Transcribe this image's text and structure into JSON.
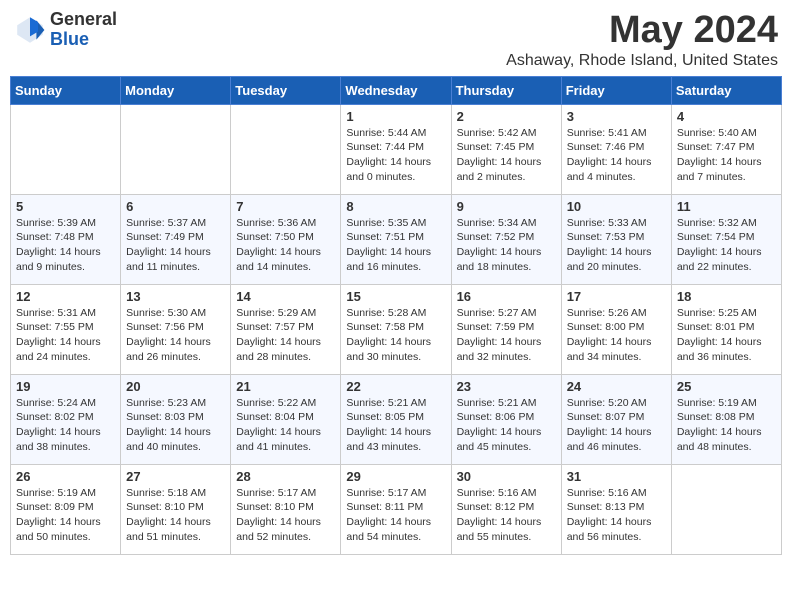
{
  "header": {
    "logo_general": "General",
    "logo_blue": "Blue",
    "title": "May 2024",
    "location": "Ashaway, Rhode Island, United States"
  },
  "weekdays": [
    "Sunday",
    "Monday",
    "Tuesday",
    "Wednesday",
    "Thursday",
    "Friday",
    "Saturday"
  ],
  "weeks": [
    [
      {
        "day": "",
        "sunrise": "",
        "sunset": "",
        "daylight": ""
      },
      {
        "day": "",
        "sunrise": "",
        "sunset": "",
        "daylight": ""
      },
      {
        "day": "",
        "sunrise": "",
        "sunset": "",
        "daylight": ""
      },
      {
        "day": "1",
        "sunrise": "Sunrise: 5:44 AM",
        "sunset": "Sunset: 7:44 PM",
        "daylight": "Daylight: 14 hours and 0 minutes."
      },
      {
        "day": "2",
        "sunrise": "Sunrise: 5:42 AM",
        "sunset": "Sunset: 7:45 PM",
        "daylight": "Daylight: 14 hours and 2 minutes."
      },
      {
        "day": "3",
        "sunrise": "Sunrise: 5:41 AM",
        "sunset": "Sunset: 7:46 PM",
        "daylight": "Daylight: 14 hours and 4 minutes."
      },
      {
        "day": "4",
        "sunrise": "Sunrise: 5:40 AM",
        "sunset": "Sunset: 7:47 PM",
        "daylight": "Daylight: 14 hours and 7 minutes."
      }
    ],
    [
      {
        "day": "5",
        "sunrise": "Sunrise: 5:39 AM",
        "sunset": "Sunset: 7:48 PM",
        "daylight": "Daylight: 14 hours and 9 minutes."
      },
      {
        "day": "6",
        "sunrise": "Sunrise: 5:37 AM",
        "sunset": "Sunset: 7:49 PM",
        "daylight": "Daylight: 14 hours and 11 minutes."
      },
      {
        "day": "7",
        "sunrise": "Sunrise: 5:36 AM",
        "sunset": "Sunset: 7:50 PM",
        "daylight": "Daylight: 14 hours and 14 minutes."
      },
      {
        "day": "8",
        "sunrise": "Sunrise: 5:35 AM",
        "sunset": "Sunset: 7:51 PM",
        "daylight": "Daylight: 14 hours and 16 minutes."
      },
      {
        "day": "9",
        "sunrise": "Sunrise: 5:34 AM",
        "sunset": "Sunset: 7:52 PM",
        "daylight": "Daylight: 14 hours and 18 minutes."
      },
      {
        "day": "10",
        "sunrise": "Sunrise: 5:33 AM",
        "sunset": "Sunset: 7:53 PM",
        "daylight": "Daylight: 14 hours and 20 minutes."
      },
      {
        "day": "11",
        "sunrise": "Sunrise: 5:32 AM",
        "sunset": "Sunset: 7:54 PM",
        "daylight": "Daylight: 14 hours and 22 minutes."
      }
    ],
    [
      {
        "day": "12",
        "sunrise": "Sunrise: 5:31 AM",
        "sunset": "Sunset: 7:55 PM",
        "daylight": "Daylight: 14 hours and 24 minutes."
      },
      {
        "day": "13",
        "sunrise": "Sunrise: 5:30 AM",
        "sunset": "Sunset: 7:56 PM",
        "daylight": "Daylight: 14 hours and 26 minutes."
      },
      {
        "day": "14",
        "sunrise": "Sunrise: 5:29 AM",
        "sunset": "Sunset: 7:57 PM",
        "daylight": "Daylight: 14 hours and 28 minutes."
      },
      {
        "day": "15",
        "sunrise": "Sunrise: 5:28 AM",
        "sunset": "Sunset: 7:58 PM",
        "daylight": "Daylight: 14 hours and 30 minutes."
      },
      {
        "day": "16",
        "sunrise": "Sunrise: 5:27 AM",
        "sunset": "Sunset: 7:59 PM",
        "daylight": "Daylight: 14 hours and 32 minutes."
      },
      {
        "day": "17",
        "sunrise": "Sunrise: 5:26 AM",
        "sunset": "Sunset: 8:00 PM",
        "daylight": "Daylight: 14 hours and 34 minutes."
      },
      {
        "day": "18",
        "sunrise": "Sunrise: 5:25 AM",
        "sunset": "Sunset: 8:01 PM",
        "daylight": "Daylight: 14 hours and 36 minutes."
      }
    ],
    [
      {
        "day": "19",
        "sunrise": "Sunrise: 5:24 AM",
        "sunset": "Sunset: 8:02 PM",
        "daylight": "Daylight: 14 hours and 38 minutes."
      },
      {
        "day": "20",
        "sunrise": "Sunrise: 5:23 AM",
        "sunset": "Sunset: 8:03 PM",
        "daylight": "Daylight: 14 hours and 40 minutes."
      },
      {
        "day": "21",
        "sunrise": "Sunrise: 5:22 AM",
        "sunset": "Sunset: 8:04 PM",
        "daylight": "Daylight: 14 hours and 41 minutes."
      },
      {
        "day": "22",
        "sunrise": "Sunrise: 5:21 AM",
        "sunset": "Sunset: 8:05 PM",
        "daylight": "Daylight: 14 hours and 43 minutes."
      },
      {
        "day": "23",
        "sunrise": "Sunrise: 5:21 AM",
        "sunset": "Sunset: 8:06 PM",
        "daylight": "Daylight: 14 hours and 45 minutes."
      },
      {
        "day": "24",
        "sunrise": "Sunrise: 5:20 AM",
        "sunset": "Sunset: 8:07 PM",
        "daylight": "Daylight: 14 hours and 46 minutes."
      },
      {
        "day": "25",
        "sunrise": "Sunrise: 5:19 AM",
        "sunset": "Sunset: 8:08 PM",
        "daylight": "Daylight: 14 hours and 48 minutes."
      }
    ],
    [
      {
        "day": "26",
        "sunrise": "Sunrise: 5:19 AM",
        "sunset": "Sunset: 8:09 PM",
        "daylight": "Daylight: 14 hours and 50 minutes."
      },
      {
        "day": "27",
        "sunrise": "Sunrise: 5:18 AM",
        "sunset": "Sunset: 8:10 PM",
        "daylight": "Daylight: 14 hours and 51 minutes."
      },
      {
        "day": "28",
        "sunrise": "Sunrise: 5:17 AM",
        "sunset": "Sunset: 8:10 PM",
        "daylight": "Daylight: 14 hours and 52 minutes."
      },
      {
        "day": "29",
        "sunrise": "Sunrise: 5:17 AM",
        "sunset": "Sunset: 8:11 PM",
        "daylight": "Daylight: 14 hours and 54 minutes."
      },
      {
        "day": "30",
        "sunrise": "Sunrise: 5:16 AM",
        "sunset": "Sunset: 8:12 PM",
        "daylight": "Daylight: 14 hours and 55 minutes."
      },
      {
        "day": "31",
        "sunrise": "Sunrise: 5:16 AM",
        "sunset": "Sunset: 8:13 PM",
        "daylight": "Daylight: 14 hours and 56 minutes."
      },
      {
        "day": "",
        "sunrise": "",
        "sunset": "",
        "daylight": ""
      }
    ]
  ]
}
